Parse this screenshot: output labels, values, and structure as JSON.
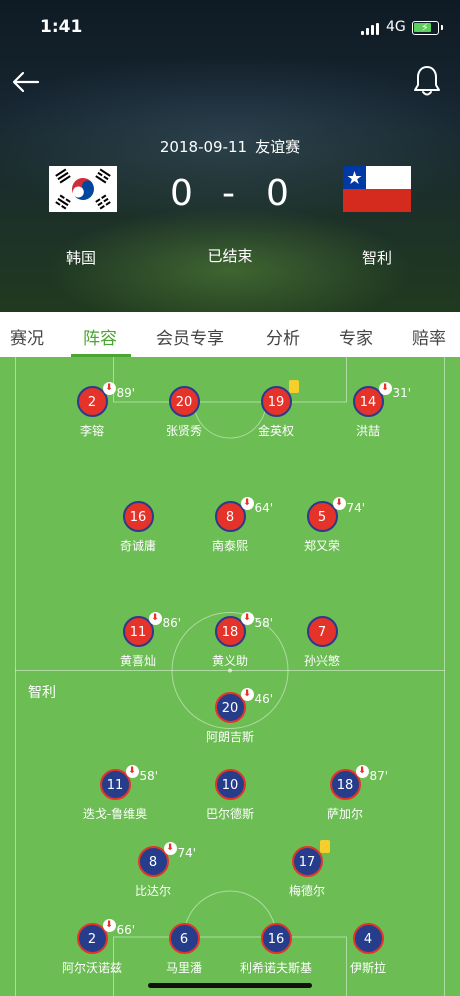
{
  "status_bar": {
    "time": "1:41",
    "network": "4G"
  },
  "match": {
    "date": "2018-09-11",
    "competition": "友谊赛",
    "home_team": "韩国",
    "away_team": "智利",
    "home_score": "0",
    "away_score": "0",
    "separator": "-",
    "status": "已结束"
  },
  "tabs": [
    {
      "label": "赛况"
    },
    {
      "label": "阵容"
    },
    {
      "label": "会员专享"
    },
    {
      "label": "分析"
    },
    {
      "label": "专家"
    },
    {
      "label": "赔率"
    }
  ],
  "active_tab": "阵容",
  "away_label": "智利",
  "home_players": [
    {
      "number": "2",
      "name": "李镕",
      "sub_minute": "89'"
    },
    {
      "number": "20",
      "name": "张贤秀"
    },
    {
      "number": "19",
      "name": "金英权",
      "card": "yellow"
    },
    {
      "number": "14",
      "name": "洪喆",
      "sub_minute": "31'"
    },
    {
      "number": "16",
      "name": "奇诚庸"
    },
    {
      "number": "8",
      "name": "南泰熙",
      "sub_minute": "64'"
    },
    {
      "number": "5",
      "name": "郑又荣",
      "sub_minute": "74'"
    },
    {
      "number": "11",
      "name": "黄喜灿",
      "sub_minute": "86'"
    },
    {
      "number": "18",
      "name": "黄义助",
      "sub_minute": "58'"
    },
    {
      "number": "7",
      "name": "孙兴慜"
    }
  ],
  "away_players": [
    {
      "number": "20",
      "name": "阿朗吉斯",
      "sub_minute": "46'"
    },
    {
      "number": "11",
      "name": "迭戈-鲁维奥",
      "sub_minute": "58'"
    },
    {
      "number": "10",
      "name": "巴尔德斯"
    },
    {
      "number": "18",
      "name": "萨加尔",
      "sub_minute": "87'"
    },
    {
      "number": "8",
      "name": "比达尔",
      "sub_minute": "74'"
    },
    {
      "number": "17",
      "name": "梅德尔",
      "card": "yellow"
    },
    {
      "number": "2",
      "name": "阿尔沃诺兹",
      "sub_minute": "66'"
    },
    {
      "number": "6",
      "name": "马里潘"
    },
    {
      "number": "16",
      "name": "利希诺夫斯基"
    },
    {
      "number": "4",
      "name": "伊斯拉"
    }
  ],
  "colors": {
    "accent": "#4aa532",
    "pitch": "#6cbd54",
    "home_kit": "#e5332a",
    "away_kit": "#253d8a",
    "yellow_card": "#f6cf2c"
  }
}
